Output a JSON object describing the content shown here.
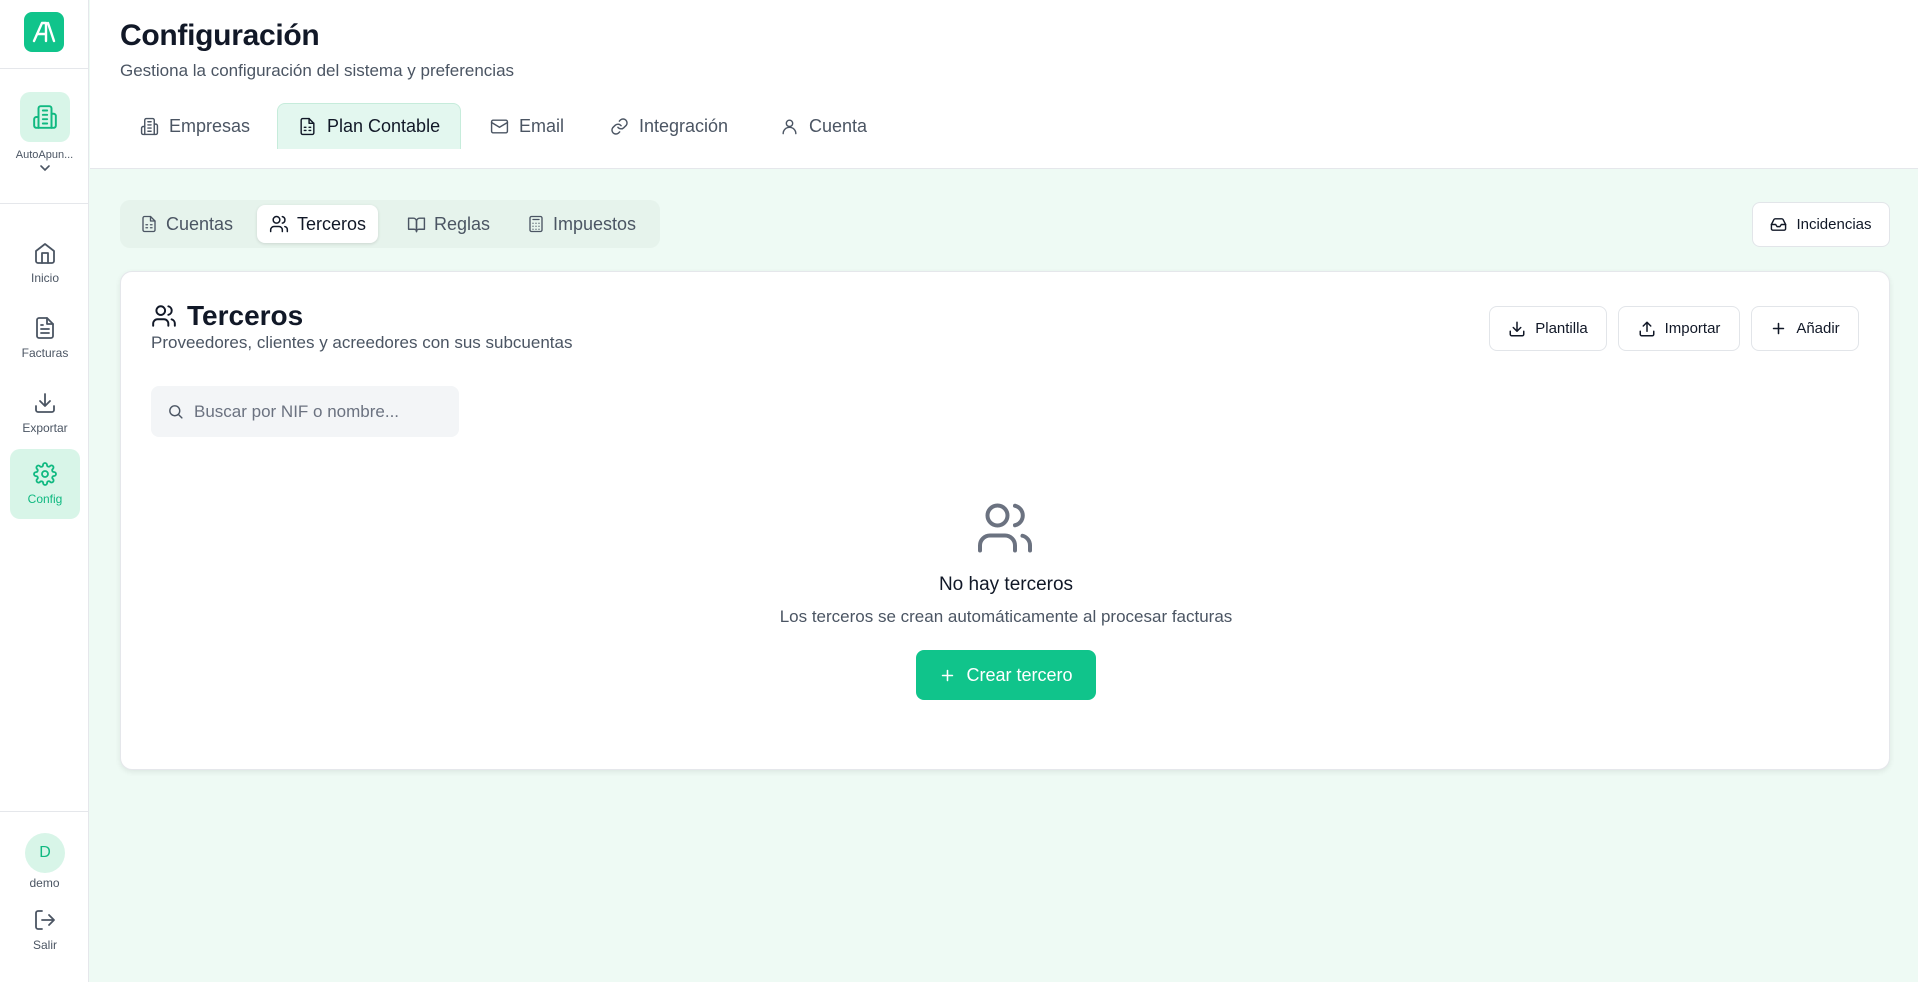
{
  "brand": {
    "logo_text": "A\\",
    "accent": "#10c48b"
  },
  "sidebar": {
    "company": {
      "name": "AutoApun...",
      "icon": "building-icon"
    },
    "items": [
      {
        "label": "Inicio",
        "icon": "home-icon",
        "active": false
      },
      {
        "label": "Facturas",
        "icon": "file-icon",
        "active": false
      },
      {
        "label": "Exportar",
        "icon": "download-icon",
        "active": false
      },
      {
        "label": "Config",
        "icon": "gear-icon",
        "active": true
      }
    ],
    "user": {
      "initial": "D",
      "name": "demo"
    },
    "logout_label": "Salir"
  },
  "header": {
    "title": "Configuración",
    "subtitle": "Gestiona la configuración del sistema y preferencias",
    "tabs": [
      {
        "label": "Empresas",
        "icon": "building-icon"
      },
      {
        "label": "Plan Contable",
        "icon": "document-icon",
        "active": true
      },
      {
        "label": "Email",
        "icon": "mail-icon"
      },
      {
        "label": "Integración",
        "icon": "link-icon"
      },
      {
        "label": "Cuenta",
        "icon": "user-icon"
      }
    ]
  },
  "subtabs": [
    {
      "label": "Cuentas",
      "icon": "document-icon"
    },
    {
      "label": "Terceros",
      "icon": "users-icon",
      "active": true
    },
    {
      "label": "Reglas",
      "icon": "book-icon"
    },
    {
      "label": "Impuestos",
      "icon": "calculator-icon"
    }
  ],
  "incidencias_label": "Incidencias",
  "card": {
    "title": "Terceros",
    "subtitle": "Proveedores, clientes y acreedores con sus subcuentas",
    "actions": {
      "template": "Plantilla",
      "import": "Importar",
      "add": "Añadir"
    },
    "search_placeholder": "Buscar por NIF o nombre...",
    "empty": {
      "title": "No hay terceros",
      "subtitle": "Los terceros se crean automáticamente al procesar facturas",
      "button": "Crear tercero"
    }
  }
}
